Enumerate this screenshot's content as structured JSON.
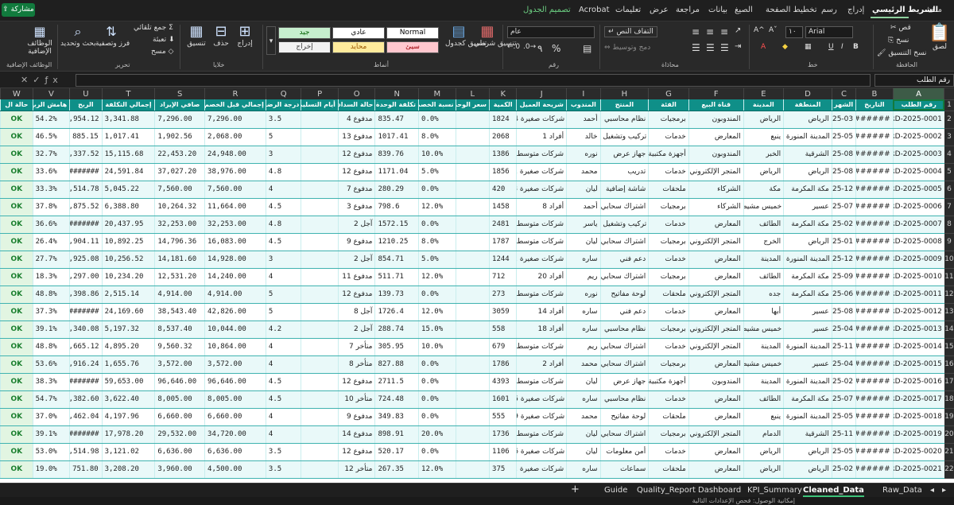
{
  "menu": {
    "tabs": [
      "ملف",
      "الشريط الرئيسي",
      "إدراج",
      "رسم",
      "تخطيط الصفحة",
      "الصيغ",
      "بيانات",
      "مراجعة",
      "عرض",
      "تعليمات",
      "Acrobat",
      "تصميم الجدول"
    ],
    "share": "مشاركة"
  },
  "ribbon": {
    "clipboard": {
      "label": "الحافظة",
      "paste": "لصق",
      "cut": "قص",
      "copy": "نسخ",
      "format_painter": "نسخ التنسيق"
    },
    "font": {
      "label": "خط",
      "name": "Arial",
      "size": "١٠",
      "bold": "B",
      "italic": "I",
      "underline": "U",
      "grow": "A^",
      "shrink": "Aˇ"
    },
    "alignment": {
      "label": "محاذاة",
      "wrap": "التفاف النص",
      "merge": "دمج وتوسيط"
    },
    "number": {
      "label": "رقم",
      "format": "عام",
      "percent": "%",
      "comma": "٩"
    },
    "styles": {
      "label": "أنماط",
      "conditional": "تنسيق شرطي",
      "as_table": "تنسيق كجدول",
      "cells": [
        "Normal",
        "عادي",
        "جيد",
        "سيئ",
        "محايد",
        "إخراج"
      ]
    },
    "cells": {
      "label": "خلايا",
      "insert": "إدراج",
      "delete": "حذف",
      "format": "تنسيق"
    },
    "editing": {
      "label": "تحرير",
      "autosum": "جمع تلقائي",
      "fill": "تعبئة",
      "clear": "مسح",
      "sort": "فرز وتصفية",
      "find": "بحث وتحديد"
    },
    "addins": {
      "label": "الوظائف الإضافية",
      "button": "الوظائف الإضافية"
    }
  },
  "formula": {
    "namebox": "رقم الطلب",
    "value": ""
  },
  "grid": {
    "columns": [
      "A",
      "B",
      "C",
      "D",
      "E",
      "F",
      "G",
      "H",
      "I",
      "J",
      "K",
      "L",
      "M",
      "N",
      "O",
      "P",
      "Q",
      "R",
      "S",
      "T",
      "U",
      "V",
      "W"
    ],
    "headers": [
      "رقم الطلب",
      "التاريخ",
      "الشهر",
      "المنطقة",
      "المدينة",
      "قناة البيع",
      "الفئة",
      "المنتج",
      "المندوب",
      "شريحة العميل",
      "الكمية",
      "سعر الوحدة",
      "نسبة الخصم",
      "تكلفة الوحدة",
      "حالة السداد",
      "أيام التسليم",
      "درجة الرضا",
      "إجمالي قبل الخصم",
      "صافي الإيراد",
      "إجمالي التكلفة",
      "الربح",
      "هامش الربح",
      "حالة ال"
    ],
    "rows": [
      [
        "ORD-2025-0001",
        "########",
        "2025-03",
        "الرياض",
        "الرياض",
        "المندوبون",
        "برمجيات",
        "نظام محاسبي",
        "أحمد",
        "شركات صغيرة 4",
        "1824",
        "0.0%",
        "835.47",
        "مدفوع 4",
        "3.5",
        "7,296.00",
        "7,296.00",
        "3,341.88",
        "3,954.12",
        "54.2%",
        "OK"
      ],
      [
        "ORD-2025-0002",
        "########",
        "2025-05",
        "المدينة المنورة",
        "ينبع",
        "المعارض",
        "خدمات",
        "تركيب وتشغيل",
        "خالد",
        "أفراد 1",
        "2068",
        "8.0%",
        "1017.41",
        "مدفوع 13",
        "5",
        "2,068.00",
        "1,902.56",
        "1,017.41",
        "885.15",
        "46.5%",
        "OK"
      ],
      [
        "ORD-2025-0003",
        "########",
        "2025-08",
        "الشرقية",
        "الخبر",
        "المندوبون",
        "أجهزة مكتبية",
        "جهاز عرض",
        "نوره",
        "شركات متوسطة 18",
        "1386",
        "10.0%",
        "839.76",
        "مدفوع 12",
        "3",
        "24,948.00",
        "22,453.20",
        "15,115.68",
        "7,337.52",
        "32.7%",
        "OK"
      ],
      [
        "ORD-2025-0004",
        "########",
        "2025-08",
        "الرياض",
        "الرياض",
        "المتجر الإلكتروني",
        "خدمات",
        "تدريب",
        "محمد",
        "شركات صغيرة 21",
        "1856",
        "5.0%",
        "1171.04",
        "مدفوع 12",
        "4.8",
        "38,976.00",
        "37,027.20",
        "24,591.84",
        "#######",
        "33.6%",
        "OK"
      ],
      [
        "ORD-2025-0005",
        "########",
        "2025-12",
        "مكة المكرمة",
        "مكة",
        "الشركاء",
        "ملحقات",
        "شاشة إضافية",
        "ليان",
        "شركات صغيرة 18",
        "420",
        "0.0%",
        "280.29",
        "مدفوع 7",
        "4",
        "7,560.00",
        "7,560.00",
        "5,045.22",
        "2,514.78",
        "33.3%",
        "OK"
      ],
      [
        "ORD-2025-0006",
        "########",
        "2025-07",
        "عسير",
        "خميس مشيط",
        "الشركاء",
        "برمجيات",
        "اشتراك سحابي",
        "أحمد",
        "أفراد 8",
        "1458",
        "12.0%",
        "798.6",
        "مدفوع 3",
        "4.5",
        "11,664.00",
        "10,264.32",
        "6,388.80",
        "3,875.52",
        "37.8%",
        "OK"
      ],
      [
        "ORD-2025-0007",
        "########",
        "2025-02",
        "مكة المكرمة",
        "الطائف",
        "المعارض",
        "خدمات",
        "تركيب وتشغيل",
        "ياسر",
        "شركات متوسطة 13",
        "2481",
        "0.0%",
        "1572.15",
        "آجل 2",
        "4.8",
        "32,253.00",
        "32,253.00",
        "20,437.95",
        "#######",
        "36.6%",
        "OK"
      ],
      [
        "ORD-2025-0008",
        "########",
        "2025-01",
        "الرياض",
        "الخرج",
        "المتجر الإلكتروني",
        "برمجيات",
        "اشتراك سحابي",
        "ليان",
        "شركات متوسطة 9",
        "1787",
        "8.0%",
        "1210.25",
        "مدفوع 9",
        "4.5",
        "16,083.00",
        "14,796.36",
        "10,892.25",
        "3,904.11",
        "26.4%",
        "OK"
      ],
      [
        "ORD-2025-0009",
        "########",
        "2025-12",
        "المدينة المنورة",
        "المدينة",
        "المعارض",
        "خدمات",
        "دعم فني",
        "ساره",
        "شركات صغيرة 12",
        "1244",
        "5.0%",
        "854.71",
        "آجل 2",
        "3",
        "14,928.00",
        "14,181.60",
        "10,256.52",
        "3,925.08",
        "27.7%",
        "OK"
      ],
      [
        "ORD-2025-0010",
        "########",
        "2025-09",
        "مكة المكرمة",
        "الطائف",
        "المعارض",
        "برمجيات",
        "اشتراك سحابي",
        "ريم",
        "أفراد 20",
        "712",
        "12.0%",
        "511.71",
        "مدفوع 11",
        "4",
        "14,240.00",
        "12,531.20",
        "10,234.20",
        "2,297.00",
        "18.3%",
        "OK"
      ],
      [
        "ORD-2025-0011",
        "########",
        "2025-06",
        "مكة المكرمة",
        "جده",
        "المتجر الإلكتروني",
        "ملحقات",
        "لوحة مفاتيح",
        "نوره",
        "شركات متوسطة 18",
        "273",
        "0.0%",
        "139.73",
        "مدفوع 12",
        "5",
        "4,914.00",
        "4,914.00",
        "2,515.14",
        "2,398.86",
        "48.8%",
        "OK"
      ],
      [
        "ORD-2025-0012",
        "########",
        "2025-08",
        "عسير",
        "أبها",
        "المعارض",
        "خدمات",
        "دعم فني",
        "ساره",
        "أفراد 14",
        "3059",
        "12.0%",
        "1726.4",
        "آجل 8",
        "5",
        "42,826.00",
        "38,543.40",
        "24,169.60",
        "#######",
        "37.3%",
        "OK"
      ],
      [
        "ORD-2025-0013",
        "########",
        "2025-04",
        "عسير",
        "خميس مشيط",
        "المتجر الإلكتروني",
        "برمجيات",
        "نظام محاسبي",
        "ساره",
        "أفراد 18",
        "558",
        "15.0%",
        "288.74",
        "آجل 2",
        "4.2",
        "10,044.00",
        "8,537.40",
        "5,197.32",
        "3,340.08",
        "39.1%",
        "OK"
      ],
      [
        "ORD-2025-0014",
        "########",
        "2025-11",
        "المدينة المنورة",
        "المدينة",
        "المتجر الإلكتروني",
        "خدمات",
        "اشتراك سحابي",
        "ريم",
        "شركات متوسطة 16",
        "679",
        "10.0%",
        "305.95",
        "متأخر 7",
        "4",
        "10,864.00",
        "9,560.32",
        "4,895.20",
        "4,665.12",
        "48.8%",
        "OK"
      ],
      [
        "ORD-2025-0015",
        "########",
        "2025-04",
        "عسير",
        "خميس مشيط",
        "المعارض",
        "برمجيات",
        "اشتراك سحابي",
        "محمد",
        "أفراد 2",
        "1786",
        "0.0%",
        "827.88",
        "متأخر 8",
        "4",
        "3,572.00",
        "3,572.00",
        "1,655.76",
        "1,916.24",
        "53.6%",
        "OK"
      ],
      [
        "ORD-2025-0016",
        "########",
        "2025-02",
        "المدينة المنورة",
        "المدينة",
        "المندوبون",
        "أجهزة مكتبية",
        "جهاز عرض",
        "ليان",
        "شركات متوسطة 22",
        "4393",
        "0.0%",
        "2711.5",
        "مدفوع 12",
        "4.5",
        "96,646.00",
        "96,646.00",
        "59,653.00",
        "#######",
        "38.3%",
        "OK"
      ],
      [
        "ORD-2025-0017",
        "########",
        "2025-07",
        "مكة المكرمة",
        "الطائف",
        "المعارض",
        "خدمات",
        "نظام محاسبي",
        "ساره",
        "شركات صغيرة 5",
        "1601",
        "0.0%",
        "724.48",
        "متأخر 10",
        "4.5",
        "8,005.00",
        "8,005.00",
        "3,622.40",
        "4,382.60",
        "54.7%",
        "OK"
      ],
      [
        "ORD-2025-0018",
        "########",
        "2025-05",
        "المدينة المنورة",
        "ينبع",
        "المعارض",
        "ملحقات",
        "لوحة مفاتيح",
        "محمد",
        "شركات صغيرة 9",
        "555",
        "0.0%",
        "349.83",
        "مدفوع 9",
        "4",
        "6,660.00",
        "6,660.00",
        "4,197.96",
        "2,462.04",
        "37.0%",
        "OK"
      ],
      [
        "ORD-2025-0019",
        "########",
        "2025-11",
        "الشرقية",
        "الدمام",
        "المتجر الإلكتروني",
        "برمجيات",
        "اشتراك سحابي",
        "ليان",
        "شركات متوسطة 16",
        "1736",
        "20.0%",
        "898.91",
        "مدفوع 14",
        "4",
        "34,720.00",
        "29,532.00",
        "17,978.20",
        "#######",
        "39.1%",
        "OK"
      ],
      [
        "ORD-2025-0020",
        "########",
        "2025-05",
        "الرياض",
        "الرياض",
        "المعارض",
        "خدمات",
        "أمن معلومات",
        "ليان",
        "شركات صغيرة 6",
        "1106",
        "0.0%",
        "520.17",
        "مدفوع 12",
        "3.5",
        "6,636.00",
        "6,636.00",
        "3,121.02",
        "3,514.98",
        "53.0%",
        "OK"
      ],
      [
        "ORD-2025-0021",
        "########",
        "2025-02",
        "الرياض",
        "الرياض",
        "المعارض",
        "ملحقات",
        "سماعات",
        "ساره",
        "شركات صغيرة 12",
        "375",
        "12.0%",
        "267.35",
        "متأخر 12",
        "3.5",
        "4,500.00",
        "3,960.00",
        "3,208.20",
        "751.80",
        "19.0%",
        "OK"
      ]
    ]
  },
  "sheets": [
    "Guide",
    "Quality_Report",
    "Dashboard",
    "KPI_Summary",
    "Cleaned_Data",
    "Raw_Data"
  ],
  "active_sheet": "Cleaned_Data",
  "status": {
    "text": "إمكانية الوصول: فحص الإعدادات التالية"
  }
}
